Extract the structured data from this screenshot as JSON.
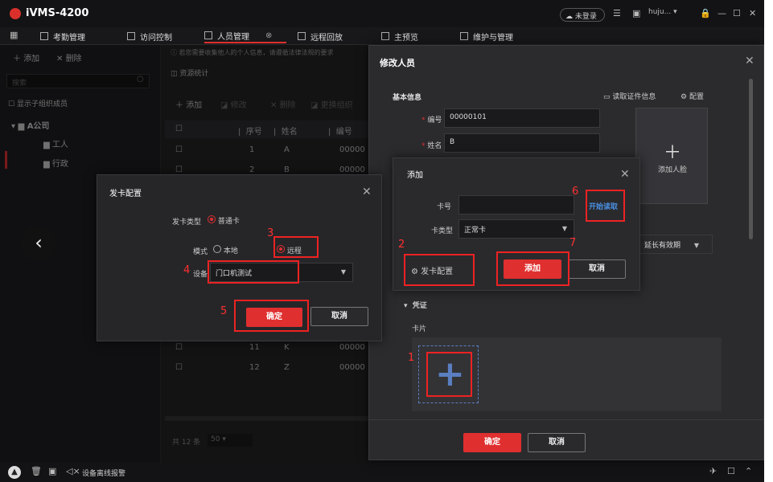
{
  "app": {
    "title": "iVMS-4200",
    "cloud": "未登录",
    "user": "huju..."
  },
  "nav": [
    "考勤管理",
    "访问控制",
    "人员管理",
    "远程回放",
    "主预览",
    "维护与管理"
  ],
  "sidebar": {
    "add": "添加",
    "delete": "删除",
    "search_placeholder": "搜索",
    "show_sub": "显示子组织成员",
    "org": "A公司",
    "children": [
      "工人",
      "行政"
    ]
  },
  "content": {
    "notice": "若您需要收集他人的个人信息，请遵循法律法规的要求",
    "stats": "资源统计",
    "toolbar": [
      "添加",
      "修改",
      "删除",
      "更换组织"
    ],
    "headers": [
      "序号",
      "姓名",
      "编号"
    ],
    "rows": [
      {
        "n": "1",
        "name": "A",
        "id": "00000"
      },
      {
        "n": "2",
        "name": "B",
        "id": "00000"
      },
      {
        "n": "11",
        "name": "K",
        "id": "00000"
      },
      {
        "n": "12",
        "name": "Z",
        "id": "00000"
      }
    ],
    "total": "共 12 条",
    "page_size": "50"
  },
  "edit": {
    "title": "修改人员",
    "basic": "基本信息",
    "read_id": "读取证件信息",
    "config": "配置",
    "id_label": "编号",
    "id_value": "00000101",
    "name_label": "姓名",
    "name_value": "B",
    "add_face": "添加人脸",
    "validity": "延长有效期",
    "credential": "凭证",
    "card": "卡片",
    "ok": "确定",
    "cancel": "取消"
  },
  "add": {
    "title": "添加",
    "card_no": "卡号",
    "card_type": "卡类型",
    "card_type_value": "正常卡",
    "start_read": "开始读取",
    "card_config": "发卡配置",
    "ok": "添加",
    "cancel": "取消"
  },
  "issue": {
    "title": "发卡配置",
    "type_label": "发卡类型",
    "type_value": "普通卡",
    "mode_label": "模式",
    "local": "本地",
    "remote": "远程",
    "device_label": "设备",
    "device_value": "门口机测试",
    "ok": "确定",
    "cancel": "取消"
  },
  "annotations": [
    "1",
    "2",
    "3",
    "4",
    "5",
    "6",
    "7"
  ],
  "status": {
    "text": "设备离线报警"
  },
  "colors": {
    "accent": "#e02f2f",
    "annotation": "#ee2222"
  }
}
